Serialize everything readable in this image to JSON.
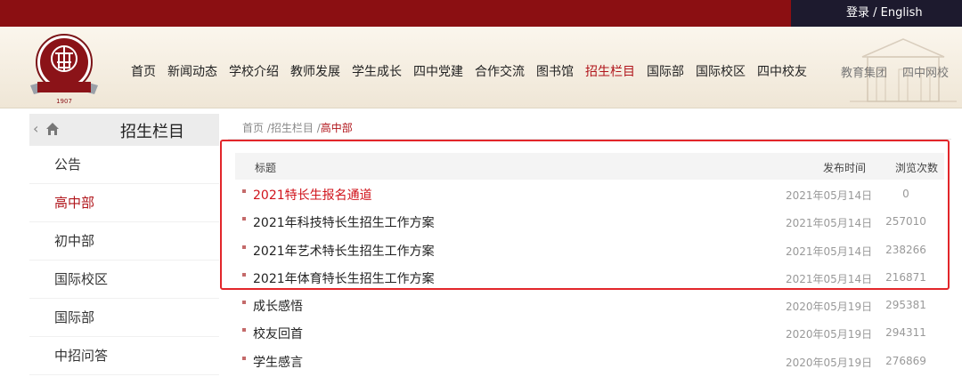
{
  "topbar": {
    "login": "登录",
    "separator": " / ",
    "english": "English"
  },
  "nav": {
    "items": [
      "首页",
      "新闻动态",
      "学校介绍",
      "教师发展",
      "学生成长",
      "四中党建",
      "合作交流",
      "图书馆",
      "招生栏目",
      "国际部",
      "国际校区",
      "四中校友"
    ],
    "active_index": 8,
    "right_items": [
      "教育集团",
      "四中网校"
    ]
  },
  "logo": {
    "year": "1907"
  },
  "sidebar": {
    "title": "招生栏目",
    "items": [
      "公告",
      "高中部",
      "初中部",
      "国际校区",
      "国际部",
      "中招问答"
    ],
    "active_index": 1
  },
  "breadcrumb": {
    "home": "首页",
    "sep": " /",
    "section": "招生栏目",
    "current": "高中部"
  },
  "table": {
    "headers": {
      "title": "标题",
      "date": "发布时间",
      "views": "浏览次数"
    },
    "rows": [
      {
        "title": "2021特长生报名通道",
        "date": "2021年05月14日",
        "views": "0",
        "hot": true
      },
      {
        "title": "2021年科技特长生招生工作方案",
        "date": "2021年05月14日",
        "views": "257010"
      },
      {
        "title": "2021年艺术特长生招生工作方案",
        "date": "2021年05月14日",
        "views": "238266"
      },
      {
        "title": "2021年体育特长生招生工作方案",
        "date": "2021年05月14日",
        "views": "216871"
      },
      {
        "title": "成长感悟",
        "date": "2020年05月19日",
        "views": "295381"
      },
      {
        "title": "校友回首",
        "date": "2020年05月19日",
        "views": "294311"
      },
      {
        "title": "学生感言",
        "date": "2020年05月19日",
        "views": "276869"
      }
    ]
  },
  "colors": {
    "brand_red": "#8b0f12",
    "accent_red": "#b0151b",
    "highlight_border": "#e2262a",
    "login_bg": "#1d1a2e"
  }
}
